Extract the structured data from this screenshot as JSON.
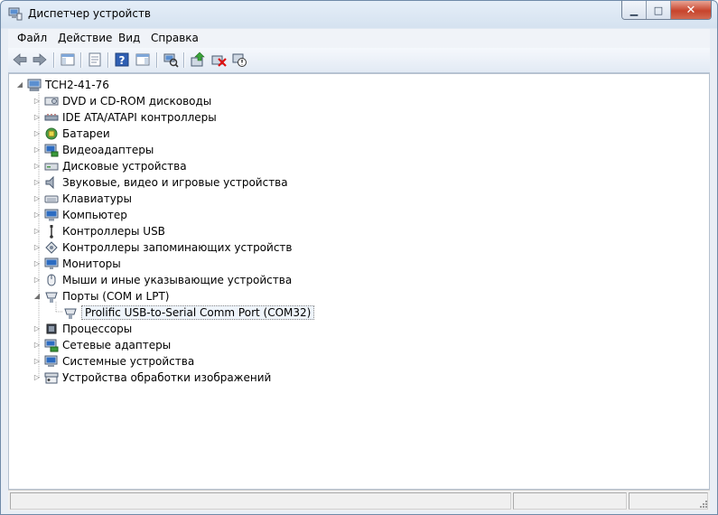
{
  "window": {
    "title": "Диспетчер устройств",
    "minimize_glyph": "▁",
    "maximize_glyph": "□",
    "close_glyph": "✕"
  },
  "menu": [
    "Файл",
    "Действие",
    "Вид",
    "Справка"
  ],
  "toolbar": {
    "icons": [
      "back-arrow-icon",
      "forward-arrow-icon",
      "show-hide-console-tree-icon",
      "properties-icon",
      "help-icon",
      "show-action-pane-icon",
      "scan-hardware-icon",
      "update-driver-icon",
      "uninstall-device-icon",
      "disable-device-icon"
    ]
  },
  "tree": {
    "root": "TCH2-41-76",
    "categories": [
      {
        "label": "DVD и CD-ROM дисководы",
        "icon": "dvd-drive-icon"
      },
      {
        "label": "IDE ATA/ATAPI контроллеры",
        "icon": "ide-controller-icon"
      },
      {
        "label": "Батареи",
        "icon": "battery-icon"
      },
      {
        "label": "Видеоадаптеры",
        "icon": "display-adapter-icon"
      },
      {
        "label": "Дисковые устройства",
        "icon": "disk-drive-icon"
      },
      {
        "label": "Звуковые, видео и игровые устройства",
        "icon": "speaker-icon"
      },
      {
        "label": "Клавиатуры",
        "icon": "keyboard-icon"
      },
      {
        "label": "Компьютер",
        "icon": "computer-icon"
      },
      {
        "label": "Контроллеры USB",
        "icon": "usb-icon"
      },
      {
        "label": "Контроллеры запоминающих устройств",
        "icon": "storage-controller-icon"
      },
      {
        "label": "Мониторы",
        "icon": "monitor-icon"
      },
      {
        "label": "Мыши и иные указывающие устройства",
        "icon": "mouse-icon"
      },
      {
        "label": "Порты (COM и LPT)",
        "icon": "port-icon",
        "expanded": true
      },
      {
        "label": "Процессоры",
        "icon": "processor-icon"
      },
      {
        "label": "Сетевые адаптеры",
        "icon": "network-adapter-icon"
      },
      {
        "label": "Системные устройства",
        "icon": "system-device-icon"
      },
      {
        "label": "Устройства обработки изображений",
        "icon": "imaging-device-icon"
      }
    ],
    "ports_child": "Prolific USB-to-Serial Comm Port (COM32)"
  },
  "colors": {
    "title_bg": "#dce7f3",
    "close_button": "#c7442c",
    "selection_bg": "#eef4fb"
  }
}
